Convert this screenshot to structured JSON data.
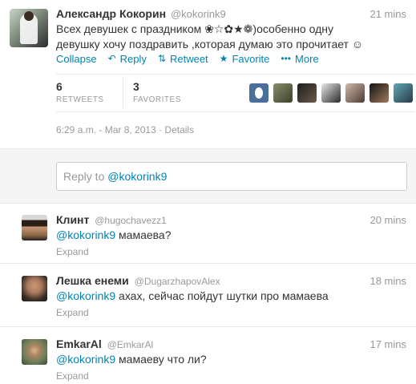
{
  "main_tweet": {
    "fullname": "Александр Кокорин",
    "username": "@kokorink9",
    "time": "21 mins",
    "text_line1": "Всех девушек с праздником ❀☆✿★❁)особенно одну",
    "text_line2": "девушку хочу поздравить ,которая думаю это прочитает ☺",
    "actions": {
      "collapse": "Collapse",
      "reply": "Reply",
      "retweet": "Retweet",
      "favorite": "Favorite",
      "more": "More"
    },
    "stats": {
      "retweets_count": "6",
      "retweets_label": "RETWEETS",
      "favorites_count": "3",
      "favorites_label": "FAVORITES"
    },
    "timestamp": "6:29 a.m. - Mar 8, 2013",
    "details": "Details"
  },
  "reply_box": {
    "prefix": "Reply to ",
    "mention": "@kokorink9"
  },
  "replies": [
    {
      "name": "Клинт",
      "user": "@hugochavezz1",
      "time": "20 mins",
      "mention": "@kokorink9",
      "text": " мамаева?",
      "expand": "Expand"
    },
    {
      "name": "Лешка енеми",
      "user": "@DugarzhapovAlex",
      "time": "18 mins",
      "mention": "@kokorink9",
      "text": " ахах, сейчас пойдут шутки про мамаева",
      "expand": "Expand"
    },
    {
      "name": "EmkarAl",
      "user": "@EmkarAl",
      "time": "17 mins",
      "mention": "@kokorink9",
      "text": " мамаеву что ли?",
      "expand": "Expand"
    }
  ]
}
